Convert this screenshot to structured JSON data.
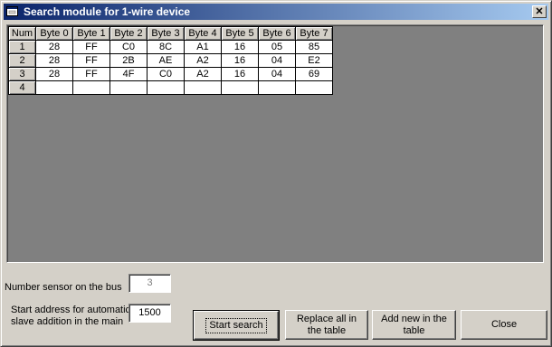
{
  "window": {
    "title": "Search module for 1-wire device"
  },
  "icons": {
    "app": "app-window-icon",
    "close": "close-icon"
  },
  "grid": {
    "corner": "Num",
    "columns": [
      "Byte 0",
      "Byte 1",
      "Byte 2",
      "Byte 3",
      "Byte 4",
      "Byte 5",
      "Byte 6",
      "Byte 7"
    ],
    "rows": [
      {
        "num": "1",
        "cells": [
          "28",
          "FF",
          "C0",
          "8C",
          "A1",
          "16",
          "05",
          "85"
        ]
      },
      {
        "num": "2",
        "cells": [
          "28",
          "FF",
          "2B",
          "AE",
          "A2",
          "16",
          "04",
          "E2"
        ]
      },
      {
        "num": "3",
        "cells": [
          "28",
          "FF",
          "4F",
          "C0",
          "A2",
          "16",
          "04",
          "69"
        ]
      },
      {
        "num": "4",
        "cells": [
          "",
          "",
          "",
          "",
          "",
          "",
          "",
          ""
        ]
      }
    ]
  },
  "form": {
    "sensor_count_label": "Number sensor on the bus",
    "sensor_count_value": "3",
    "start_address_label_line1": "Start address for automatic",
    "start_address_label_line2": "slave addition in the main",
    "start_address_value": "1500"
  },
  "buttons": {
    "start_search": "Start search",
    "replace_all_line1": "Replace all in",
    "replace_all_line2": "the table",
    "add_new_line1": "Add new in the",
    "add_new_line2": "table",
    "close": "Close"
  },
  "colors": {
    "title_start": "#0a246a",
    "title_end": "#a6caf0",
    "face": "#d4d0c8",
    "grid_bg": "#808080"
  }
}
